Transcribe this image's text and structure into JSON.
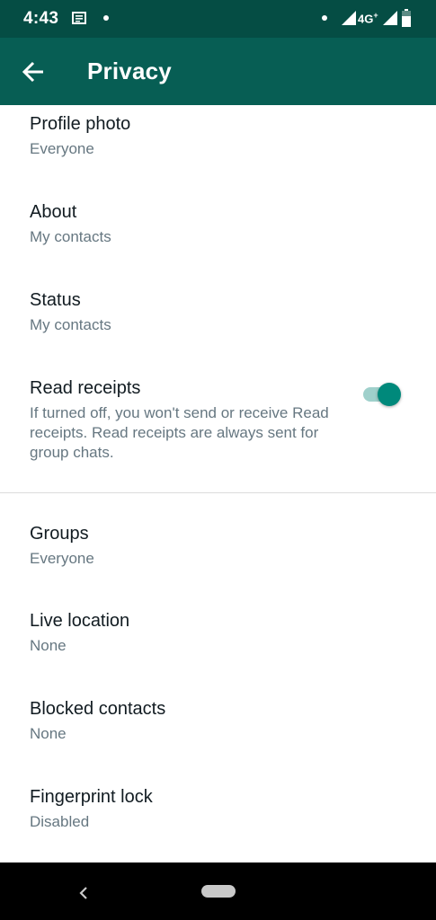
{
  "status_bar": {
    "time": "4:43",
    "network": "4G"
  },
  "app_bar": {
    "title": "Privacy"
  },
  "settings": [
    {
      "title": "Profile photo",
      "value": "Everyone"
    },
    {
      "title": "About",
      "value": "My contacts"
    },
    {
      "title": "Status",
      "value": "My contacts"
    }
  ],
  "read_receipts": {
    "title": "Read receipts",
    "description": "If turned off, you won't send or receive Read receipts. Read receipts are always sent for group chats.",
    "enabled": true
  },
  "settings_more": [
    {
      "title": "Groups",
      "value": "Everyone"
    },
    {
      "title": "Live location",
      "value": "None"
    },
    {
      "title": "Blocked contacts",
      "value": "None"
    },
    {
      "title": "Fingerprint lock",
      "value": "Disabled"
    }
  ],
  "colors": {
    "status_bar": "#054d44",
    "app_bar": "#075e54",
    "toggle_thumb": "#00897b",
    "toggle_track": "#9fd0cb"
  }
}
